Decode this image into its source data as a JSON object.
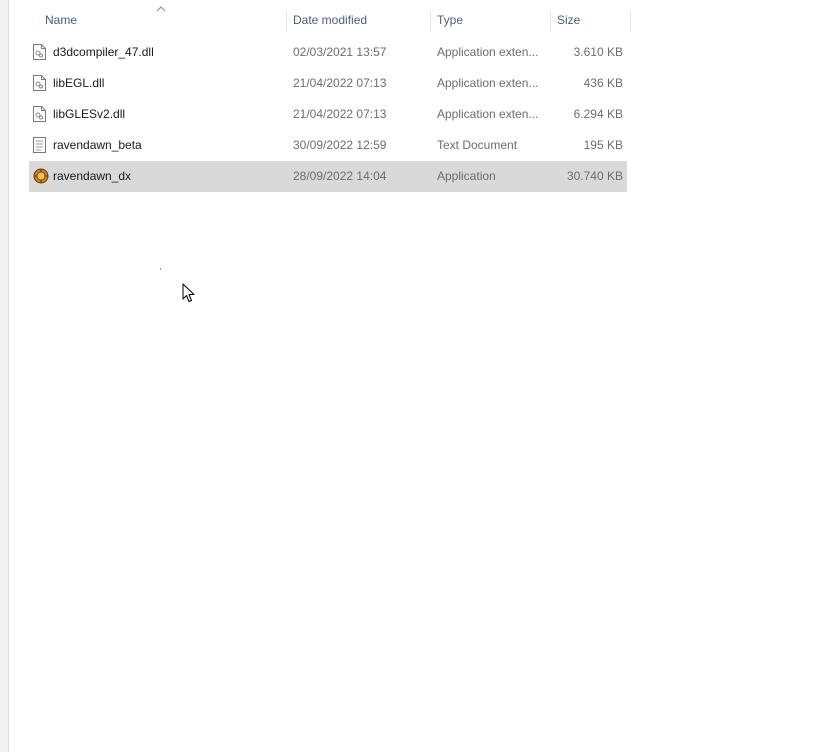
{
  "columns": {
    "name": "Name",
    "date": "Date modified",
    "type": "Type",
    "size": "Size"
  },
  "files": [
    {
      "name": "d3dcompiler_47.dll",
      "date": "02/03/2021 13:57",
      "type": "Application exten...",
      "size": "3.610 KB",
      "icon": "dll-file-icon",
      "selected": false
    },
    {
      "name": "libEGL.dll",
      "date": "21/04/2022 07:13",
      "type": "Application exten...",
      "size": "436 KB",
      "icon": "dll-file-icon",
      "selected": false
    },
    {
      "name": "libGLESv2.dll",
      "date": "21/04/2022 07:13",
      "type": "Application exten...",
      "size": "6.294 KB",
      "icon": "dll-file-icon",
      "selected": false
    },
    {
      "name": "ravendawn_beta",
      "date": "30/09/2022 12:59",
      "type": "Text Document",
      "size": "195 KB",
      "icon": "text-document-icon",
      "selected": false
    },
    {
      "name": "ravendawn_dx",
      "date": "28/09/2022 14:04",
      "type": "Application",
      "size": "30.740 KB",
      "icon": "application-icon",
      "selected": true
    }
  ],
  "colors": {
    "header_text": "#4c607a",
    "selected_row": "#d9d9d9",
    "meta_text": "#6d6d6d"
  }
}
